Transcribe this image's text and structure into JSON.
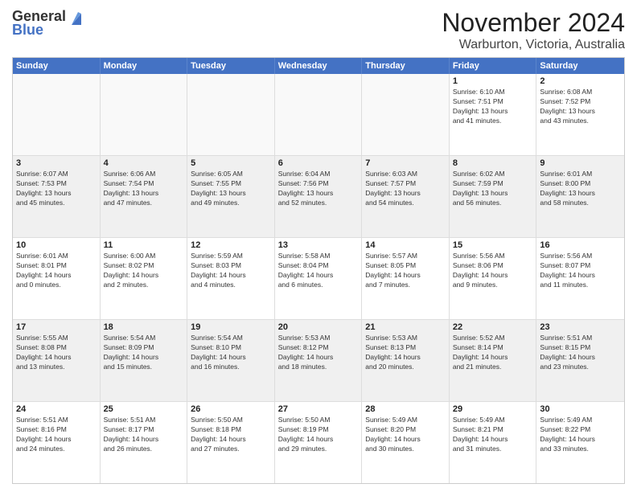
{
  "header": {
    "logo_general": "General",
    "logo_blue": "Blue",
    "month_title": "November 2024",
    "location": "Warburton, Victoria, Australia"
  },
  "calendar": {
    "days": [
      "Sunday",
      "Monday",
      "Tuesday",
      "Wednesday",
      "Thursday",
      "Friday",
      "Saturday"
    ],
    "rows": [
      [
        {
          "day": "",
          "empty": true
        },
        {
          "day": "",
          "empty": true
        },
        {
          "day": "",
          "empty": true
        },
        {
          "day": "",
          "empty": true
        },
        {
          "day": "",
          "empty": true
        },
        {
          "day": "1",
          "text": "Sunrise: 6:10 AM\nSunset: 7:51 PM\nDaylight: 13 hours\nand 41 minutes."
        },
        {
          "day": "2",
          "text": "Sunrise: 6:08 AM\nSunset: 7:52 PM\nDaylight: 13 hours\nand 43 minutes."
        }
      ],
      [
        {
          "day": "3",
          "text": "Sunrise: 6:07 AM\nSunset: 7:53 PM\nDaylight: 13 hours\nand 45 minutes."
        },
        {
          "day": "4",
          "text": "Sunrise: 6:06 AM\nSunset: 7:54 PM\nDaylight: 13 hours\nand 47 minutes."
        },
        {
          "day": "5",
          "text": "Sunrise: 6:05 AM\nSunset: 7:55 PM\nDaylight: 13 hours\nand 49 minutes."
        },
        {
          "day": "6",
          "text": "Sunrise: 6:04 AM\nSunset: 7:56 PM\nDaylight: 13 hours\nand 52 minutes."
        },
        {
          "day": "7",
          "text": "Sunrise: 6:03 AM\nSunset: 7:57 PM\nDaylight: 13 hours\nand 54 minutes."
        },
        {
          "day": "8",
          "text": "Sunrise: 6:02 AM\nSunset: 7:59 PM\nDaylight: 13 hours\nand 56 minutes."
        },
        {
          "day": "9",
          "text": "Sunrise: 6:01 AM\nSunset: 8:00 PM\nDaylight: 13 hours\nand 58 minutes."
        }
      ],
      [
        {
          "day": "10",
          "text": "Sunrise: 6:01 AM\nSunset: 8:01 PM\nDaylight: 14 hours\nand 0 minutes."
        },
        {
          "day": "11",
          "text": "Sunrise: 6:00 AM\nSunset: 8:02 PM\nDaylight: 14 hours\nand 2 minutes."
        },
        {
          "day": "12",
          "text": "Sunrise: 5:59 AM\nSunset: 8:03 PM\nDaylight: 14 hours\nand 4 minutes."
        },
        {
          "day": "13",
          "text": "Sunrise: 5:58 AM\nSunset: 8:04 PM\nDaylight: 14 hours\nand 6 minutes."
        },
        {
          "day": "14",
          "text": "Sunrise: 5:57 AM\nSunset: 8:05 PM\nDaylight: 14 hours\nand 7 minutes."
        },
        {
          "day": "15",
          "text": "Sunrise: 5:56 AM\nSunset: 8:06 PM\nDaylight: 14 hours\nand 9 minutes."
        },
        {
          "day": "16",
          "text": "Sunrise: 5:56 AM\nSunset: 8:07 PM\nDaylight: 14 hours\nand 11 minutes."
        }
      ],
      [
        {
          "day": "17",
          "text": "Sunrise: 5:55 AM\nSunset: 8:08 PM\nDaylight: 14 hours\nand 13 minutes."
        },
        {
          "day": "18",
          "text": "Sunrise: 5:54 AM\nSunset: 8:09 PM\nDaylight: 14 hours\nand 15 minutes."
        },
        {
          "day": "19",
          "text": "Sunrise: 5:54 AM\nSunset: 8:10 PM\nDaylight: 14 hours\nand 16 minutes."
        },
        {
          "day": "20",
          "text": "Sunrise: 5:53 AM\nSunset: 8:12 PM\nDaylight: 14 hours\nand 18 minutes."
        },
        {
          "day": "21",
          "text": "Sunrise: 5:53 AM\nSunset: 8:13 PM\nDaylight: 14 hours\nand 20 minutes."
        },
        {
          "day": "22",
          "text": "Sunrise: 5:52 AM\nSunset: 8:14 PM\nDaylight: 14 hours\nand 21 minutes."
        },
        {
          "day": "23",
          "text": "Sunrise: 5:51 AM\nSunset: 8:15 PM\nDaylight: 14 hours\nand 23 minutes."
        }
      ],
      [
        {
          "day": "24",
          "text": "Sunrise: 5:51 AM\nSunset: 8:16 PM\nDaylight: 14 hours\nand 24 minutes."
        },
        {
          "day": "25",
          "text": "Sunrise: 5:51 AM\nSunset: 8:17 PM\nDaylight: 14 hours\nand 26 minutes."
        },
        {
          "day": "26",
          "text": "Sunrise: 5:50 AM\nSunset: 8:18 PM\nDaylight: 14 hours\nand 27 minutes."
        },
        {
          "day": "27",
          "text": "Sunrise: 5:50 AM\nSunset: 8:19 PM\nDaylight: 14 hours\nand 29 minutes."
        },
        {
          "day": "28",
          "text": "Sunrise: 5:49 AM\nSunset: 8:20 PM\nDaylight: 14 hours\nand 30 minutes."
        },
        {
          "day": "29",
          "text": "Sunrise: 5:49 AM\nSunset: 8:21 PM\nDaylight: 14 hours\nand 31 minutes."
        },
        {
          "day": "30",
          "text": "Sunrise: 5:49 AM\nSunset: 8:22 PM\nDaylight: 14 hours\nand 33 minutes."
        }
      ]
    ]
  }
}
